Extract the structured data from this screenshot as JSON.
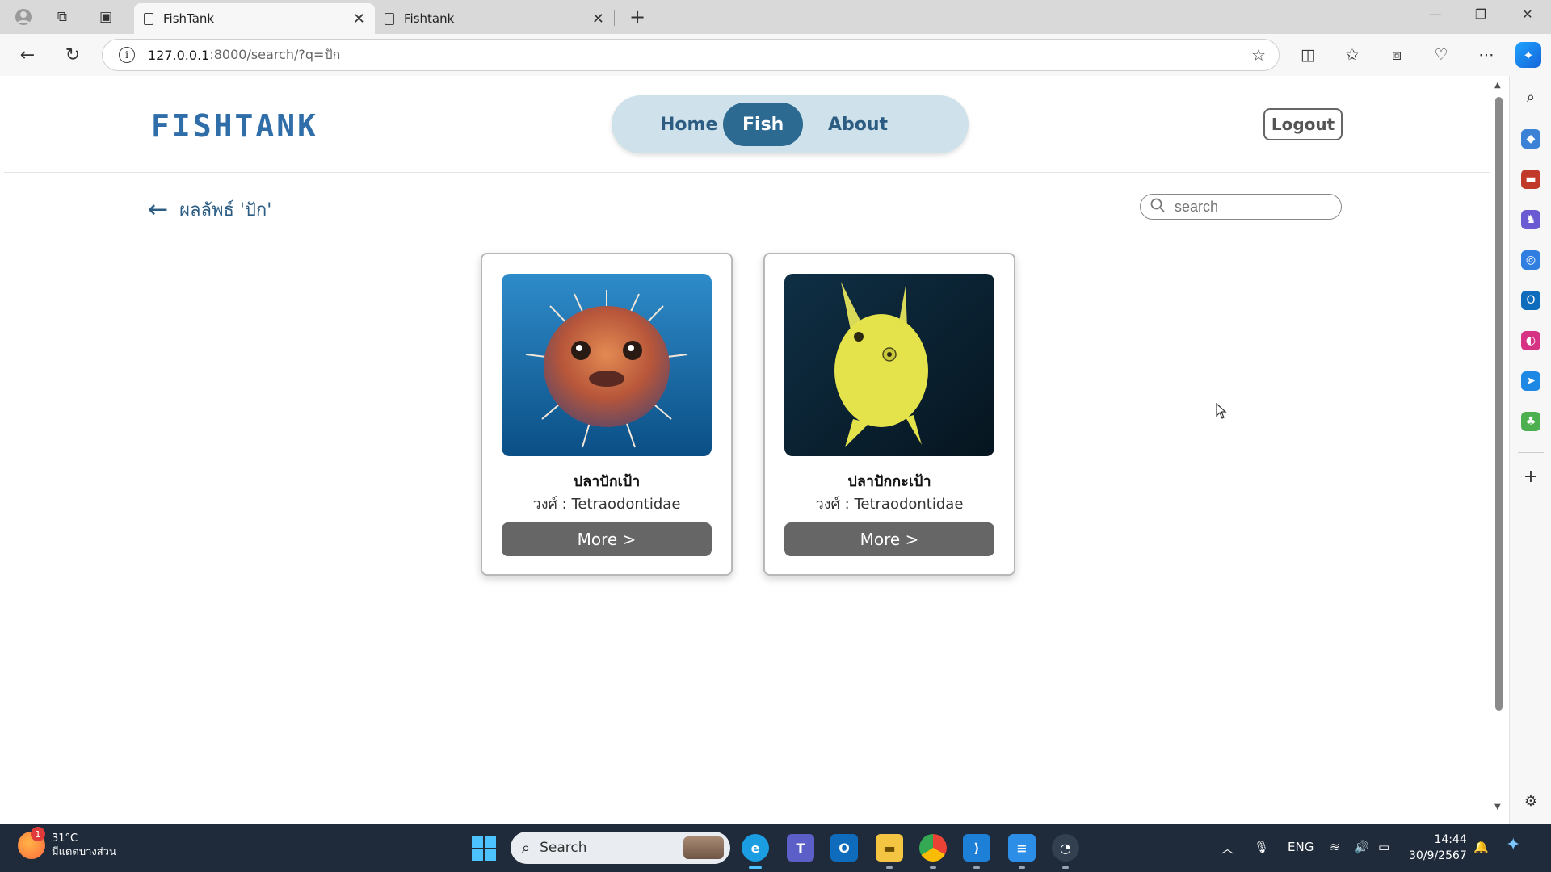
{
  "browser": {
    "tabs": [
      {
        "title": "FishTank",
        "active": true
      },
      {
        "title": "Fishtank",
        "active": false
      }
    ],
    "url_host": "127.0.0.1",
    "url_path": ":8000/search/?q=ปัก"
  },
  "site": {
    "logo": "FISHTANK",
    "nav": [
      {
        "label": "Home",
        "active": false
      },
      {
        "label": "Fish",
        "active": true
      },
      {
        "label": "About",
        "active": false
      }
    ],
    "logout_label": "Logout"
  },
  "results": {
    "heading": "ผลลัพธ์ 'ปัก'",
    "search_placeholder": "search"
  },
  "cards": [
    {
      "name": "ปลาปักเป้า",
      "family": "วงศ์ : Tetraodontidae",
      "button": "More >",
      "image": "pufferfish photo"
    },
    {
      "name": "ปลาปักกะเป้า",
      "family": "วงศ์ : Tetraodontidae",
      "button": "More >",
      "image": "yellow cowfish photo"
    }
  ],
  "taskbar": {
    "weather_temp": "31°C",
    "weather_desc": "มีแดดบางส่วน",
    "weather_badge": "1",
    "search_label": "Search",
    "lang": "ENG",
    "time": "14:44",
    "date": "30/9/2567"
  },
  "colors": {
    "brand": "#2f6ea8",
    "nav_pill": "#cfe1ea",
    "nav_active": "#2c6a92",
    "button_gray": "#666666"
  }
}
